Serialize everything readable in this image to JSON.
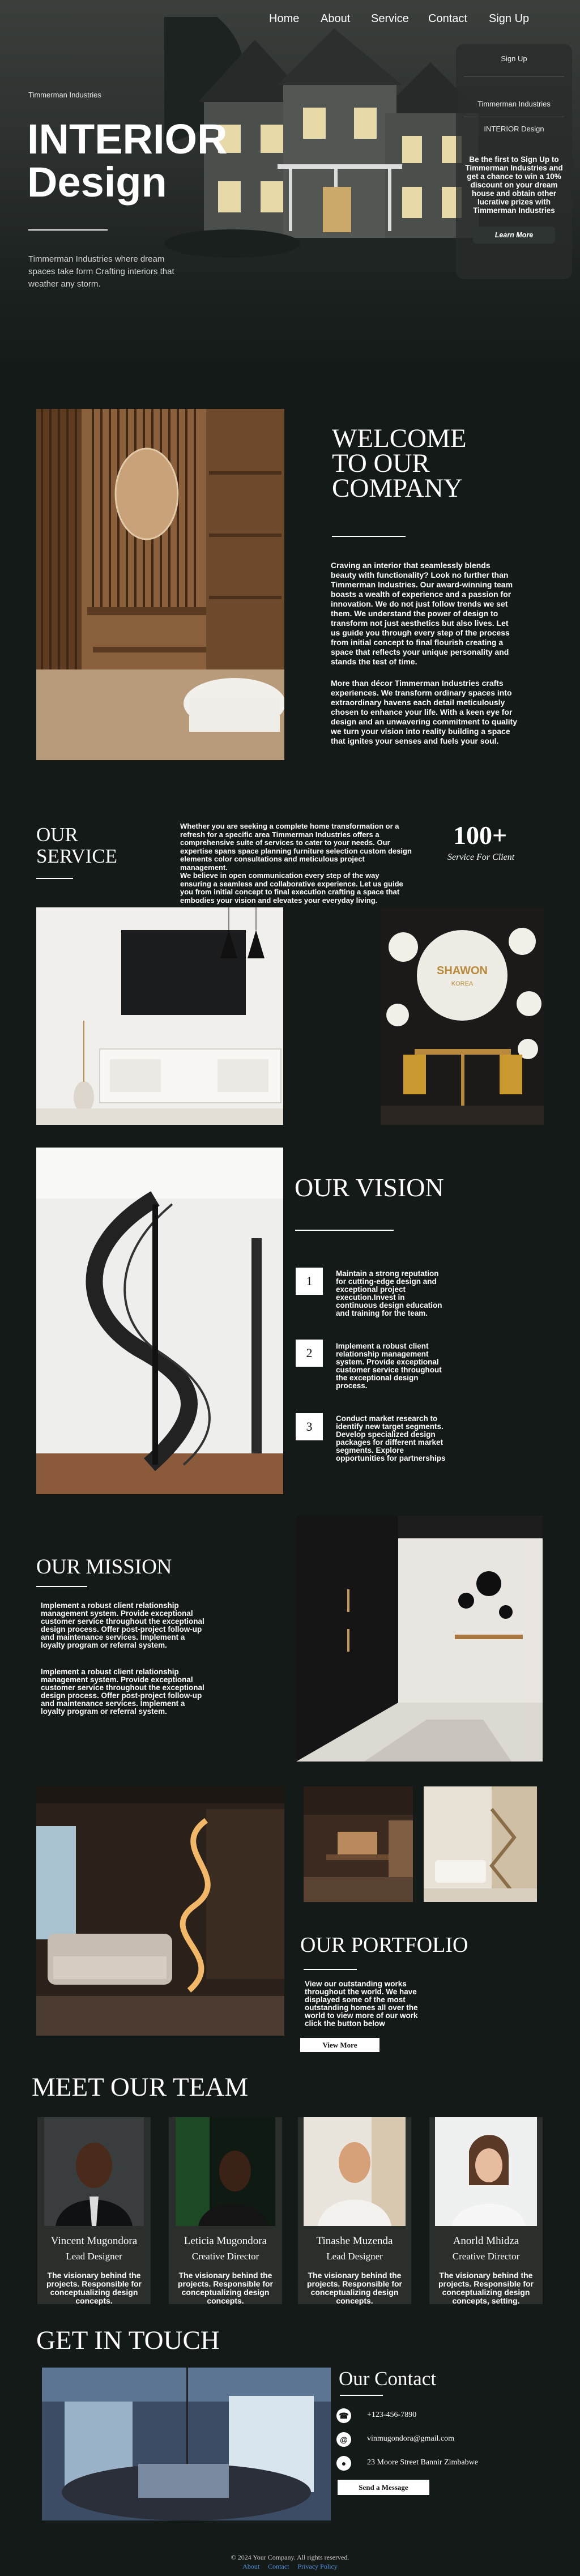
{
  "nav": {
    "items": [
      "Home",
      "About",
      "Service",
      "Contact",
      "Sign Up"
    ]
  },
  "side_panel": {
    "items": [
      "Sign Up",
      "Timmerman Industries",
      "INTERIOR Design"
    ],
    "promo": "Be the first to Sign Up to Timmerman Industries and get a chance to win a 10% discount on your dream house and obtain other lucrative prizes with Timmerman Industries",
    "button": "Learn More"
  },
  "hero": {
    "brand": "Timmerman Industries",
    "title_line1": "INTERIOR",
    "title_line2": "Design",
    "subtitle": "Timmerman Industries where dream spaces take form Crafting interiors that weather any storm."
  },
  "welcome": {
    "title": [
      "WELCOME",
      "TO OUR",
      "COMPANY"
    ],
    "para1": "Craving an interior that seamlessly blends beauty with functionality? Look no further than Timmerman Industries. Our award-winning team boasts a wealth of experience and a passion for innovation. We do not just follow trends we set them. We understand the power of design to transform not just aesthetics but also lives. Let us guide you through every step of the process from initial concept to final flourish creating a space that reflects your unique personality and stands the test of time.",
    "para2": "More than décor Timmerman Industries crafts experiences. We transform ordinary spaces into extraordinary havens each detail meticulously chosen to enhance your life. With a keen eye for design and an unwavering commitment to quality we turn your vision into reality building a space that ignites your senses and fuels your soul."
  },
  "service": {
    "title_line1": "OUR",
    "title_line2": "SERVICE",
    "text": "Whether you are seeking a complete home transformation or a refresh for a specific area Timmerman Industries offers a comprehensive suite of services to cater to your needs. Our expertise spans space planning furniture selection custom design elements color consultations and meticulous project management.\nWe believe in open communication every step of the way ensuring a seamless and collaborative experience. Let us guide you from initial concept to final execution crafting a space that embodies your vision and elevates your everyday living.",
    "stat": "100+",
    "stat_label": "Service For Client",
    "sign_text": "SHAWON KOREA"
  },
  "vision": {
    "title": "OUR VISION",
    "items": [
      {
        "num": "1",
        "text": "Maintain a strong reputation for cutting-edge design and exceptional project execution.Invest in continuous design education and training for the team."
      },
      {
        "num": "2",
        "text": "Implement a robust client relationship management system. Provide exceptional customer service throughout the exceptional design process."
      },
      {
        "num": "3",
        "text": "Conduct market research to identify new target segments. Develop specialized design packages for different market segments. Explore opportunities for partnerships"
      }
    ]
  },
  "mission": {
    "title": "OUR MISSION",
    "para1": "Implement a robust client relationship management system. Provide exceptional customer service throughout the exceptional design process. Offer post-project follow-up and maintenance services. Implement a loyalty program or referral system.",
    "para2": "Implement a robust client relationship management system. Provide exceptional customer service throughout the exceptional design process. Offer post-project follow-up and maintenance services. Implement a loyalty program or referral system."
  },
  "portfolio": {
    "title": "OUR PORTFOLIO",
    "text": "View our outstanding works throughout the world. We have displayed some of the most outstanding homes all over the world to view more of our work click the button below",
    "button": "View More"
  },
  "team": {
    "title": "MEET OUR TEAM",
    "members": [
      {
        "name": "Vincent Mugondora",
        "role": "Lead Designer",
        "desc": "The visionary behind the projects. Responsible for conceptualizing design concepts."
      },
      {
        "name": "Leticia Mugondora",
        "role": "Creative Director",
        "desc": "The visionary behind the projects. Responsible for conceptualizing design concepts."
      },
      {
        "name": "Tinashe Muzenda",
        "role": "Lead Designer",
        "desc": "The visionary behind the projects. Responsible for conceptualizing design concepts."
      },
      {
        "name": "Anorld Mhidza",
        "role": "Creative Director",
        "desc": "The visionary behind the projects. Responsible for conceptualizing design concepts, setting."
      }
    ]
  },
  "contact": {
    "section_title": "GET IN TOUCH",
    "title": "Our Contact",
    "phone": "+123-456-7890",
    "email": "vinmugondora@gmail.com",
    "address": "23 Moore Street Bannir Zimbabwe",
    "button": "Send a Message"
  },
  "footer": {
    "copyright": "© 2024 Your Company. All rights reserved.",
    "links": [
      "About",
      "Contact",
      "Privacy Policy"
    ]
  }
}
